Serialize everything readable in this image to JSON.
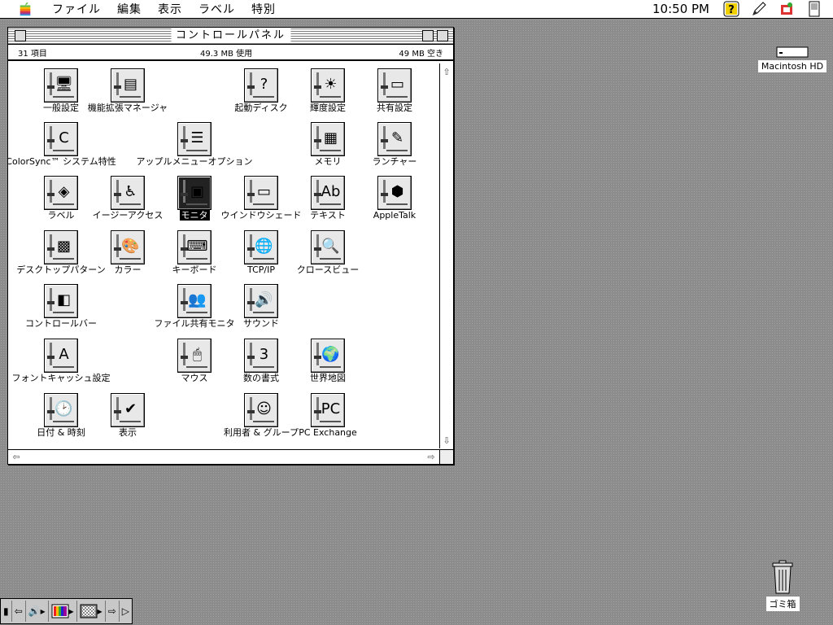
{
  "menubar": {
    "menus": [
      "ファイル",
      "編集",
      "表示",
      "ラベル",
      "特別"
    ],
    "clock": "10:50 PM",
    "icons": [
      "help-icon",
      "pencil-icon",
      "application-menu-icon",
      "pda-icon"
    ]
  },
  "window": {
    "title": "コントロールパネル",
    "info": {
      "items": "31 項目",
      "used": "49.3 MB 使用",
      "free": "49 MB 空き"
    }
  },
  "control_panels": [
    {
      "label": "一般設定",
      "icon": "general-controls-icon",
      "glyph": "🖥"
    },
    {
      "label": "機能拡張マネージャ",
      "icon": "extensions-manager-icon",
      "glyph": "▤"
    },
    {
      "label": "起動ディスク",
      "icon": "startup-disk-icon",
      "glyph": "?"
    },
    {
      "label": "輝度設定",
      "icon": "brightness-icon",
      "glyph": "☀"
    },
    {
      "label": "共有設定",
      "icon": "sharing-setup-icon",
      "glyph": "▭"
    },
    {
      "label": "ColorSync™ システム特性",
      "icon": "colorsync-icon",
      "glyph": "C"
    },
    {
      "label": "アップルメニューオプション",
      "icon": "apple-menu-options-icon",
      "glyph": "☰"
    },
    {
      "label": "メモリ",
      "icon": "memory-icon",
      "glyph": "▦"
    },
    {
      "label": "ランチャー",
      "icon": "launcher-icon",
      "glyph": "✎"
    },
    {
      "label": "ラベル",
      "icon": "labels-icon",
      "glyph": "◈"
    },
    {
      "label": "イージーアクセス",
      "icon": "easy-access-icon",
      "glyph": "♿"
    },
    {
      "label": "モニタ",
      "icon": "monitors-icon",
      "glyph": "▣"
    },
    {
      "label": "ウインドウシェード",
      "icon": "windowshade-icon",
      "glyph": "▭"
    },
    {
      "label": "テキスト",
      "icon": "text-icon",
      "glyph": "Ab"
    },
    {
      "label": "AppleTalk",
      "icon": "appletalk-icon",
      "glyph": "⬢"
    },
    {
      "label": "デスクトップパターン",
      "icon": "desktop-patterns-icon",
      "glyph": "▩"
    },
    {
      "label": "カラー",
      "icon": "color-icon",
      "glyph": "🎨"
    },
    {
      "label": "キーボード",
      "icon": "keyboard-icon",
      "glyph": "⌨"
    },
    {
      "label": "TCP/IP",
      "icon": "tcpip-icon",
      "glyph": "🌐"
    },
    {
      "label": "クロースビュー",
      "icon": "closeview-icon",
      "glyph": "🔍"
    },
    {
      "label": "コントロールバー",
      "icon": "control-strip-icon",
      "glyph": "◧"
    },
    {
      "label": "ファイル共有モニタ",
      "icon": "file-sharing-monitor-icon",
      "glyph": "👥"
    },
    {
      "label": "サウンド",
      "icon": "sound-icon",
      "glyph": "🔊"
    },
    {
      "label": "フォントキャッシュ設定",
      "icon": "font-cache-icon",
      "glyph": "A"
    },
    {
      "label": "マウス",
      "icon": "mouse-icon",
      "glyph": "🖱"
    },
    {
      "label": "数の書式",
      "icon": "numbers-icon",
      "glyph": "3"
    },
    {
      "label": "世界地図",
      "icon": "map-icon",
      "glyph": "🌍"
    },
    {
      "label": "日付 & 時刻",
      "icon": "date-time-icon",
      "glyph": "🕑"
    },
    {
      "label": "表示",
      "icon": "views-icon",
      "glyph": "✔"
    },
    {
      "label": "利用者 & グループ",
      "icon": "users-groups-icon",
      "glyph": "☺"
    },
    {
      "label": "PC Exchange",
      "icon": "pc-exchange-icon",
      "glyph": "PC"
    }
  ],
  "desktop": {
    "hd_label": "Macintosh HD",
    "trash_label": "ゴミ箱"
  },
  "control_strip": [
    "collapse-icon",
    "left-arrow-icon",
    "volume-icon",
    "monitor-bit-depth-icon",
    "desktop-pattern-icon",
    "right-arrow-icon",
    "strip-end-icon"
  ]
}
